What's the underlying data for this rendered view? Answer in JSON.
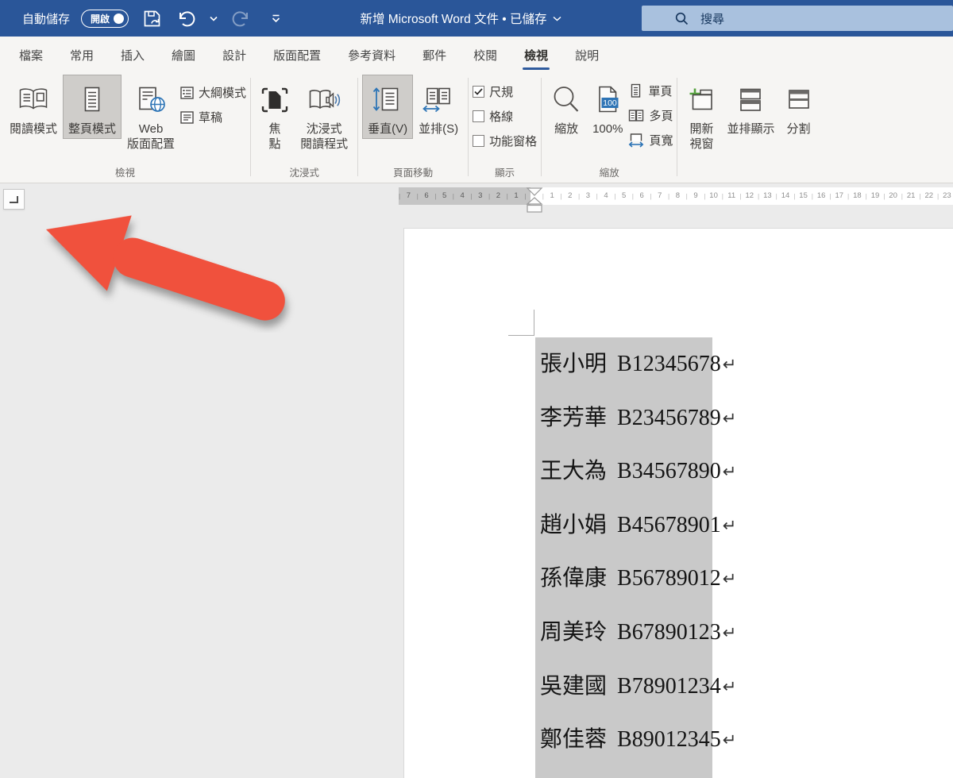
{
  "titlebar": {
    "autosave_label": "自動儲存",
    "autosave_state": "開啟",
    "title": "新增 Microsoft Word 文件 • 已儲存",
    "search_placeholder": "搜尋"
  },
  "tabs": [
    {
      "label": "檔案",
      "active": false
    },
    {
      "label": "常用",
      "active": false
    },
    {
      "label": "插入",
      "active": false
    },
    {
      "label": "繪圖",
      "active": false
    },
    {
      "label": "設計",
      "active": false
    },
    {
      "label": "版面配置",
      "active": false
    },
    {
      "label": "參考資料",
      "active": false
    },
    {
      "label": "郵件",
      "active": false
    },
    {
      "label": "校閱",
      "active": false
    },
    {
      "label": "檢視",
      "active": true
    },
    {
      "label": "說明",
      "active": false
    }
  ],
  "ribbon": {
    "view_group": {
      "label": "檢視",
      "read_mode": "閱讀模式",
      "print_layout": "整頁模式",
      "web_layout_line1": "Web",
      "web_layout_line2": "版面配置",
      "outline": "大綱模式",
      "draft": "草稿"
    },
    "immersive_group": {
      "label": "沈浸式",
      "focus_line1": "焦",
      "focus_line2": "點",
      "reader_line1": "沈浸式",
      "reader_line2": "閱讀程式"
    },
    "movement_group": {
      "label": "頁面移動",
      "vertical": "垂直(V)",
      "side_to_side": "並排(S)"
    },
    "show_group": {
      "label": "顯示",
      "ruler": "尺規",
      "gridlines": "格線",
      "nav_pane": "功能窗格"
    },
    "zoom_group": {
      "label": "縮放",
      "zoom": "縮放",
      "zoom_value": "100%",
      "zoom_badge": "100",
      "one_page": "單頁",
      "multiple_pages": "多頁",
      "page_width": "頁寬"
    },
    "window_group": {
      "new_window_line1": "開新",
      "new_window_line2": "視窗",
      "side_by_side": "並排顯示",
      "split": "分割"
    }
  },
  "ruler": {
    "left_numbers": [
      7,
      6,
      5,
      4,
      3,
      2,
      1
    ],
    "right_numbers": [
      1,
      2,
      3,
      4,
      5,
      6,
      7,
      8,
      9,
      10,
      11,
      12,
      13,
      14,
      15,
      16,
      17,
      18,
      19,
      20,
      21,
      22,
      23
    ]
  },
  "document": {
    "return_mark": "↵",
    "rows": [
      {
        "name": "張小明",
        "id": "B12345678"
      },
      {
        "name": "李芳華",
        "id": "B23456789"
      },
      {
        "name": "王大為",
        "id": "B34567890"
      },
      {
        "name": "趙小娟",
        "id": "B45678901"
      },
      {
        "name": "孫偉康",
        "id": "B56789012"
      },
      {
        "name": "周美玲",
        "id": "B67890123"
      },
      {
        "name": "吳建國",
        "id": "B78901234"
      },
      {
        "name": "鄭佳蓉",
        "id": "B89012345"
      }
    ]
  },
  "colors": {
    "titlebar": "#2a5699",
    "accent": "#2f5b9d",
    "icon_blue": "#2e75b6",
    "icon_green": "#57a33f",
    "selection": "#c9c9c9",
    "arrow_red": "#f0513d"
  }
}
